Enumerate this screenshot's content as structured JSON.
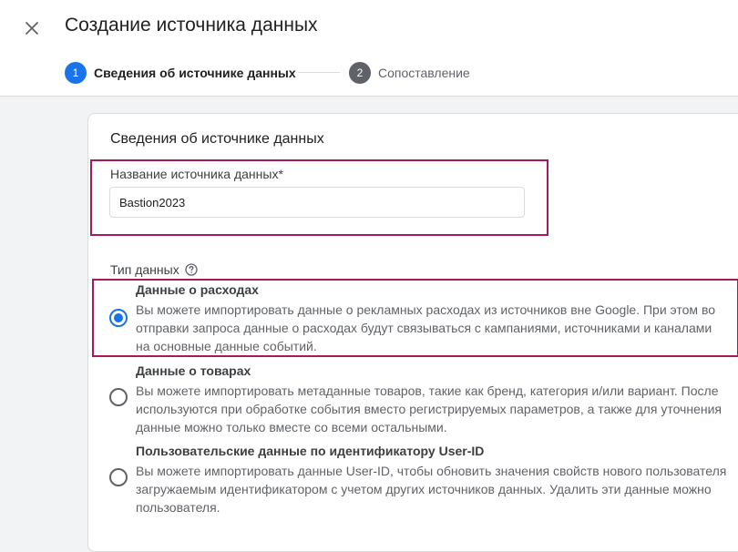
{
  "header": {
    "title": "Создание источника данных",
    "close_icon": "close-icon"
  },
  "stepper": {
    "steps": [
      {
        "number": "1",
        "label": "Сведения об источнике данных",
        "state": "active"
      },
      {
        "number": "2",
        "label": "Сопоставление",
        "state": "inactive"
      }
    ]
  },
  "card": {
    "section_title": "Сведения об источнике данных",
    "name_field": {
      "label": "Название источника данных*",
      "value": "Bastion2023"
    },
    "data_type": {
      "label": "Тип данных",
      "help_icon": "help-circle-icon",
      "options": [
        {
          "title": "Данные о расходах",
          "selected": true,
          "lines": [
            "Вы можете импортировать данные о рекламных расходах из источников вне Google. При этом во",
            "отправки запроса данные о расходах будут связываться с кампаниями, источниками и каналами",
            "на основные данные событий."
          ]
        },
        {
          "title": "Данные о товарах",
          "selected": false,
          "lines": [
            "Вы можете импортировать метаданные товаров, такие как бренд, категория и/или вариант. После",
            "используются при обработке события вместо регистрируемых параметров, а также для уточнения",
            "данные можно только вместе со всеми остальными."
          ]
        },
        {
          "title": "Пользовательские данные по идентификатору User-ID",
          "selected": false,
          "lines": [
            "Вы можете импортировать данные User-ID, чтобы обновить значения свойств нового пользователя",
            "загружаемым идентификатором с учетом других источников данных. Удалить эти данные можно",
            "пользователя."
          ]
        }
      ]
    }
  },
  "colors": {
    "accent": "#1a73e8",
    "highlight": "#a5195f",
    "inactive_step": "#5f6368"
  }
}
